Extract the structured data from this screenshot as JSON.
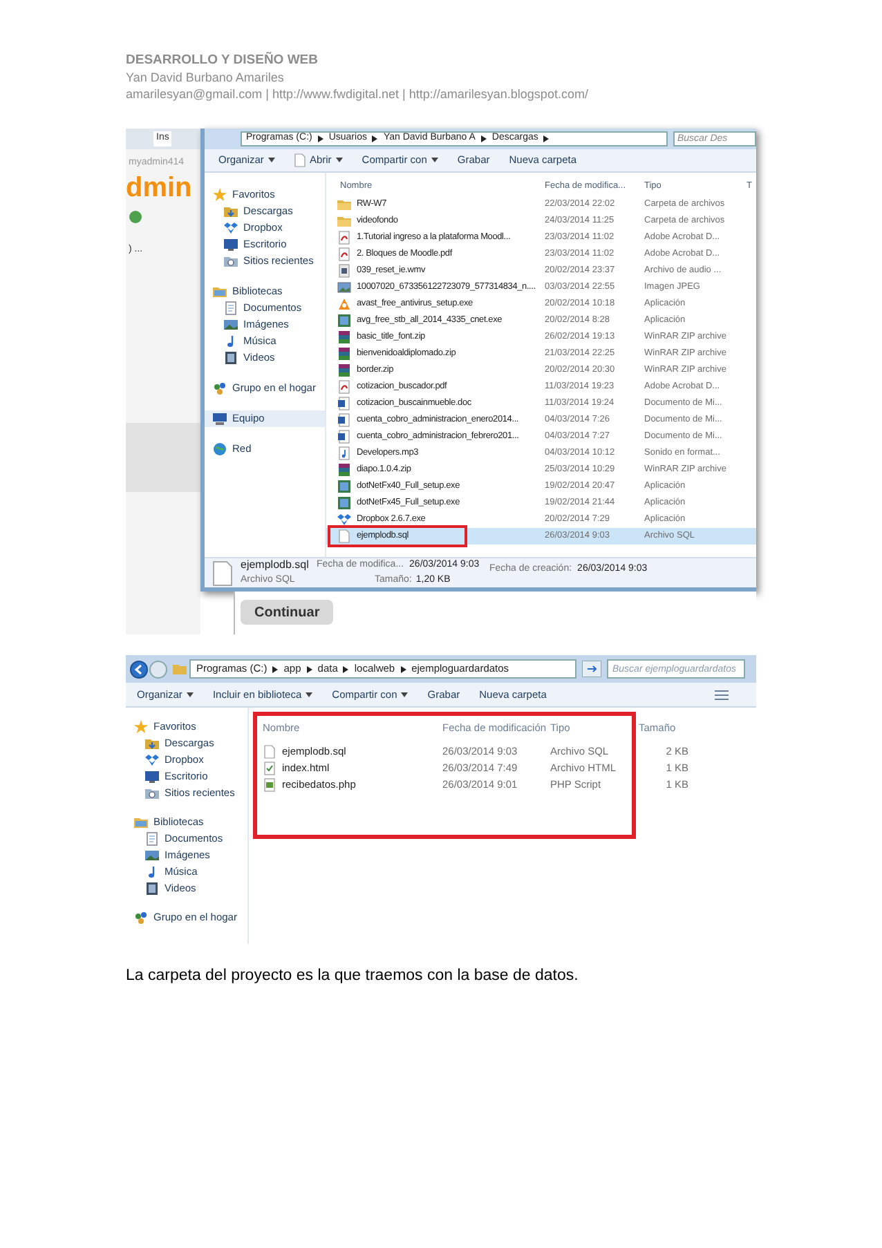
{
  "header": {
    "title": "DESARROLLO Y DISEÑO WEB",
    "author": "Yan David Burbano Amariles",
    "contact": "amarilesyan@gmail.com | http://www.fwdigital.net | http://amarilesyan.blogspot.com/"
  },
  "screenshot_1": {
    "browser_behind": {
      "tab": "Ins",
      "address": "myadmin414",
      "logo": "dmin",
      "field": ") ...",
      "button": "Continuar"
    },
    "breadcrumb": [
      "Programas (C:)",
      "Usuarios",
      "Yan David Burbano A",
      "Descargas"
    ],
    "search": {
      "placeholder": "Buscar Des"
    },
    "toolbar": [
      {
        "label": "Organizar",
        "dropdown": true,
        "file_icon": false
      },
      {
        "label": "Abrir",
        "dropdown": true,
        "file_icon": true
      },
      {
        "label": "Compartir con",
        "dropdown": true,
        "file_icon": false
      },
      {
        "label": "Grabar",
        "dropdown": false,
        "file_icon": false
      },
      {
        "label": "Nueva carpeta",
        "dropdown": false,
        "file_icon": false
      }
    ],
    "nav": [
      {
        "label": "Favoritos",
        "kind": "star",
        "selected": false,
        "children": [
          {
            "label": "Descargas",
            "kind": "download",
            "selected": false
          },
          {
            "label": "Dropbox",
            "kind": "dropbox",
            "selected": false
          },
          {
            "label": "Escritorio",
            "kind": "desktop",
            "selected": false
          },
          {
            "label": "Sitios recientes",
            "kind": "recent",
            "selected": false
          }
        ]
      },
      {
        "label": "Bibliotecas",
        "kind": "library",
        "selected": false,
        "children": [
          {
            "label": "Documentos",
            "kind": "document",
            "selected": false
          },
          {
            "label": "Imágenes",
            "kind": "image",
            "selected": false
          },
          {
            "label": "Música",
            "kind": "music",
            "selected": false
          },
          {
            "label": "Videos",
            "kind": "video",
            "selected": false
          }
        ]
      },
      {
        "label": "Grupo en el hogar",
        "kind": "homegroup",
        "selected": false
      },
      {
        "label": "Equipo",
        "kind": "computer",
        "selected": true
      },
      {
        "label": "Red",
        "kind": "network",
        "selected": false
      }
    ],
    "columns": [
      "Nombre",
      "Fecha de modifica...",
      "Tipo",
      "T"
    ],
    "rows": [
      {
        "name": "RW-W7",
        "date": "22/03/2014 22:02",
        "type": "Carpeta de archivos",
        "kind": "folder",
        "selected": false,
        "marked": false
      },
      {
        "name": "videofondo",
        "date": "24/03/2014 11:25",
        "type": "Carpeta de archivos",
        "kind": "folder",
        "selected": false,
        "marked": false
      },
      {
        "name": "1.Tutorial ingreso a la plataforma Moodl...",
        "date": "23/03/2014 11:02",
        "type": "Adobe Acrobat D...",
        "kind": "pdf",
        "selected": false,
        "marked": false
      },
      {
        "name": "2. Bloques de Moodle.pdf",
        "date": "23/03/2014 11:02",
        "type": "Adobe Acrobat D...",
        "kind": "pdf",
        "selected": false,
        "marked": false
      },
      {
        "name": "039_reset_ie.wmv",
        "date": "20/02/2014 23:37",
        "type": "Archivo de audio ...",
        "kind": "video",
        "selected": false,
        "marked": false
      },
      {
        "name": "10007020_673356122723079_577314834_n....",
        "date": "03/03/2014 22:55",
        "type": "Imagen JPEG",
        "kind": "image",
        "selected": false,
        "marked": false
      },
      {
        "name": "avast_free_antivirus_setup.exe",
        "date": "20/02/2014 10:18",
        "type": "Aplicación",
        "kind": "installer",
        "selected": false,
        "marked": false
      },
      {
        "name": "avg_free_stb_all_2014_4335_cnet.exe",
        "date": "20/02/2014 8:28",
        "type": "Aplicación",
        "kind": "app",
        "selected": false,
        "marked": false
      },
      {
        "name": "basic_title_font.zip",
        "date": "26/02/2014 19:13",
        "type": "WinRAR ZIP archive",
        "kind": "zip",
        "selected": false,
        "marked": false
      },
      {
        "name": "bienvenidoaldiplomado.zip",
        "date": "21/03/2014 22:25",
        "type": "WinRAR ZIP archive",
        "kind": "zip",
        "selected": false,
        "marked": false
      },
      {
        "name": "border.zip",
        "date": "20/02/2014 20:30",
        "type": "WinRAR ZIP archive",
        "kind": "zip",
        "selected": false,
        "marked": false
      },
      {
        "name": "cotizacion_buscador.pdf",
        "date": "11/03/2014 19:23",
        "type": "Adobe Acrobat D...",
        "kind": "pdf",
        "selected": false,
        "marked": false
      },
      {
        "name": "cotizacion_buscainmueble.doc",
        "date": "11/03/2014 19:24",
        "type": "Documento de Mi...",
        "kind": "doc",
        "selected": false,
        "marked": false
      },
      {
        "name": "cuenta_cobro_administracion_enero2014...",
        "date": "04/03/2014 7:26",
        "type": "Documento de Mi...",
        "kind": "doc",
        "selected": false,
        "marked": false
      },
      {
        "name": "cuenta_cobro_administracion_febrero201...",
        "date": "04/03/2014 7:27",
        "type": "Documento de Mi...",
        "kind": "doc",
        "selected": false,
        "marked": false
      },
      {
        "name": "Developers.mp3",
        "date": "04/03/2014 10:12",
        "type": "Sonido en format...",
        "kind": "audio",
        "selected": false,
        "marked": false
      },
      {
        "name": "diapo.1.0.4.zip",
        "date": "25/03/2014 10:29",
        "type": "WinRAR ZIP archive",
        "kind": "zip",
        "selected": false,
        "marked": false
      },
      {
        "name": "dotNetFx40_Full_setup.exe",
        "date": "19/02/2014 20:47",
        "type": "Aplicación",
        "kind": "app",
        "selected": false,
        "marked": false
      },
      {
        "name": "dotNetFx45_Full_setup.exe",
        "date": "19/02/2014 21:44",
        "type": "Aplicación",
        "kind": "app",
        "selected": false,
        "marked": false
      },
      {
        "name": "Dropbox 2.6.7.exe",
        "date": "20/02/2014 7:29",
        "type": "Aplicación",
        "kind": "dropbox",
        "selected": false,
        "marked": false
      },
      {
        "name": "ejemplodb.sql",
        "date": "26/03/2014 9:03",
        "type": "Archivo SQL",
        "kind": "blank",
        "selected": true,
        "marked": true
      }
    ],
    "details": {
      "name": "ejemplodb.sql",
      "type": "Archivo SQL",
      "modified_label": "Fecha de modifica...",
      "modified": "26/03/2014 9:03",
      "size_label": "Tamaño:",
      "size": "1,20 KB",
      "created_label": "Fecha de creación:",
      "created": "26/03/2014 9:03"
    }
  },
  "screenshot_2": {
    "breadcrumb": [
      "Programas (C:)",
      "app",
      "data",
      "localweb",
      "ejemploguardardatos"
    ],
    "search": {
      "placeholder": "Buscar ejemploguardardatos"
    },
    "toolbar": [
      {
        "label": "Organizar",
        "dropdown": true
      },
      {
        "label": "Incluir en biblioteca",
        "dropdown": true
      },
      {
        "label": "Compartir con",
        "dropdown": true
      },
      {
        "label": "Grabar",
        "dropdown": false
      },
      {
        "label": "Nueva carpeta",
        "dropdown": false
      }
    ],
    "nav": [
      {
        "label": "Favoritos",
        "kind": "star",
        "selected": false,
        "children": [
          {
            "label": "Descargas",
            "kind": "download",
            "selected": false
          },
          {
            "label": "Dropbox",
            "kind": "dropbox",
            "selected": false
          },
          {
            "label": "Escritorio",
            "kind": "desktop",
            "selected": false
          },
          {
            "label": "Sitios recientes",
            "kind": "recent",
            "selected": false
          }
        ]
      },
      {
        "label": "Bibliotecas",
        "kind": "library",
        "selected": false,
        "children": [
          {
            "label": "Documentos",
            "kind": "document",
            "selected": false
          },
          {
            "label": "Imágenes",
            "kind": "image",
            "selected": false
          },
          {
            "label": "Música",
            "kind": "music",
            "selected": false
          },
          {
            "label": "Videos",
            "kind": "video",
            "selected": false
          }
        ]
      },
      {
        "label": "Grupo en el hogar",
        "kind": "homegroup",
        "selected": false
      }
    ],
    "columns": [
      "Nombre",
      "Fecha de modificación",
      "Tipo",
      "Tamaño"
    ],
    "highlight_box": true,
    "rows": [
      {
        "name": "ejemplodb.sql",
        "date": "26/03/2014 9:03",
        "type": "Archivo SQL",
        "size": "2 KB",
        "kind": "blank",
        "selected": false
      },
      {
        "name": "index.html",
        "date": "26/03/2014 7:49",
        "type": "Archivo HTML",
        "size": "1 KB",
        "kind": "html",
        "selected": false
      },
      {
        "name": "recibedatos.php",
        "date": "26/03/2014 9:01",
        "type": "PHP Script",
        "size": "1 KB",
        "kind": "php",
        "selected": false
      }
    ]
  },
  "caption": "La carpeta del proyecto es la que traemos con la base de datos."
}
